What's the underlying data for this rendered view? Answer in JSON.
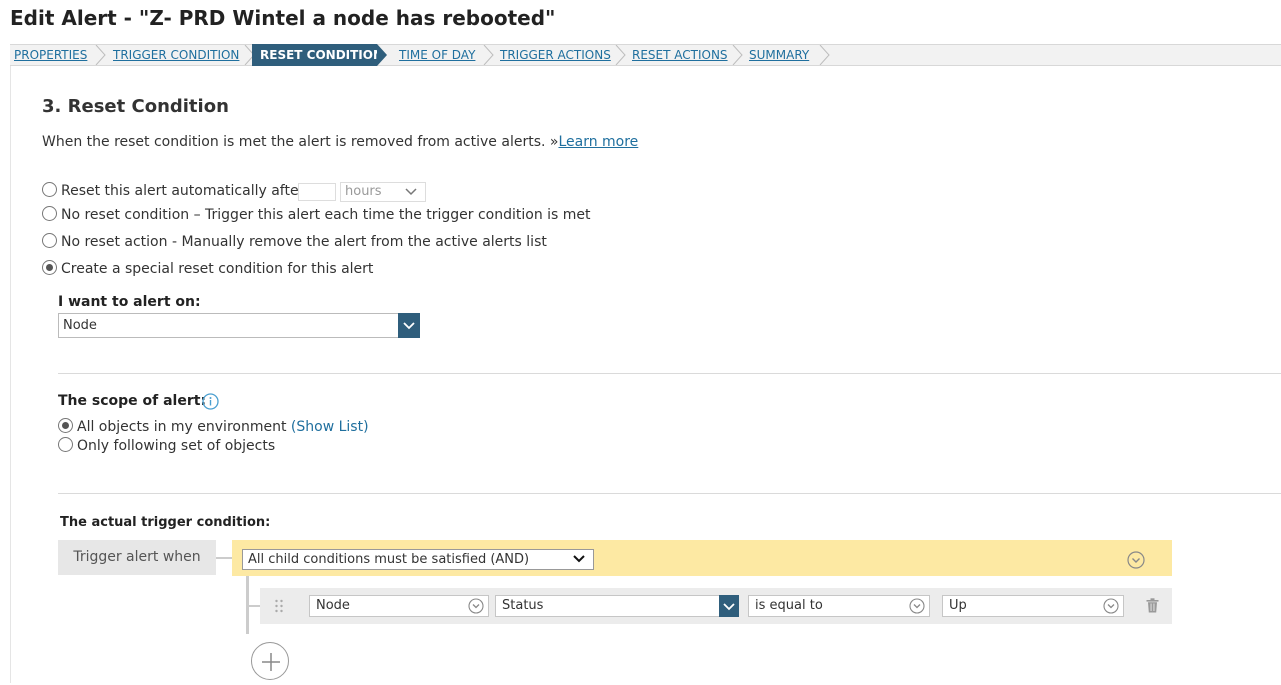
{
  "page": {
    "title": "Edit Alert - \"Z- PRD Wintel a node has rebooted\""
  },
  "breadcrumb": {
    "steps": [
      {
        "label": "PROPERTIES",
        "active": false
      },
      {
        "label": "TRIGGER CONDITION",
        "active": false
      },
      {
        "label": "RESET CONDITION",
        "active": true
      },
      {
        "label": "TIME OF DAY",
        "active": false
      },
      {
        "label": "TRIGGER ACTIONS",
        "active": false
      },
      {
        "label": "RESET ACTIONS",
        "active": false
      },
      {
        "label": "SUMMARY",
        "active": false
      }
    ]
  },
  "section": {
    "title": "3. Reset Condition",
    "description": "When the reset condition is met the alert is removed from active alerts. »",
    "learn_more": "Learn more"
  },
  "reset_options": [
    {
      "label": "Reset this alert automatically after",
      "selected": false
    },
    {
      "label": "No reset condition – Trigger this alert each time the trigger condition is met",
      "selected": false
    },
    {
      "label": "No reset action - Manually remove the alert from the active alerts list",
      "selected": false
    },
    {
      "label": "Create a special reset condition for this alert",
      "selected": true
    }
  ],
  "auto_reset": {
    "amount": "",
    "unit": "hours"
  },
  "alert_on": {
    "label": "I want to alert on:",
    "value": "Node"
  },
  "scope": {
    "label": "The scope of alert:",
    "all_objects": "All objects in my environment",
    "show_list": "(Show List)",
    "following_set": "Only following set of objects",
    "selected": "all"
  },
  "trigger": {
    "label": "The actual trigger condition:",
    "when_label": "Trigger alert when",
    "group_operator": "All child conditions must be satisfied (AND)",
    "condition": {
      "object": "Node",
      "field": "Status",
      "operator": "is equal to",
      "value": "Up"
    }
  },
  "colors": {
    "accent": "#2f5e7c",
    "link": "#1f6f9e",
    "group_bar": "#fde9a3"
  }
}
